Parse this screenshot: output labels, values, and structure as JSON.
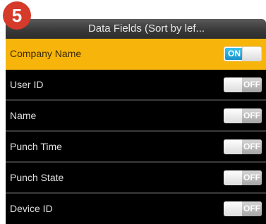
{
  "step_badge": "5",
  "header": {
    "title": "Data Fields (Sort by lef..."
  },
  "fields": [
    {
      "label": "Company Name",
      "state": "ON",
      "selected": true
    },
    {
      "label": "User ID",
      "state": "OFF",
      "selected": false
    },
    {
      "label": "Name",
      "state": "OFF",
      "selected": false
    },
    {
      "label": "Punch Time",
      "state": "OFF",
      "selected": false
    },
    {
      "label": "Punch State",
      "state": "OFF",
      "selected": false
    },
    {
      "label": "Device ID",
      "state": "OFF",
      "selected": false
    }
  ],
  "colors": {
    "badge": "#d53a2a",
    "selected_row": "#f7b50c",
    "on_toggle": "#1892c9",
    "list_background": "#000000"
  }
}
